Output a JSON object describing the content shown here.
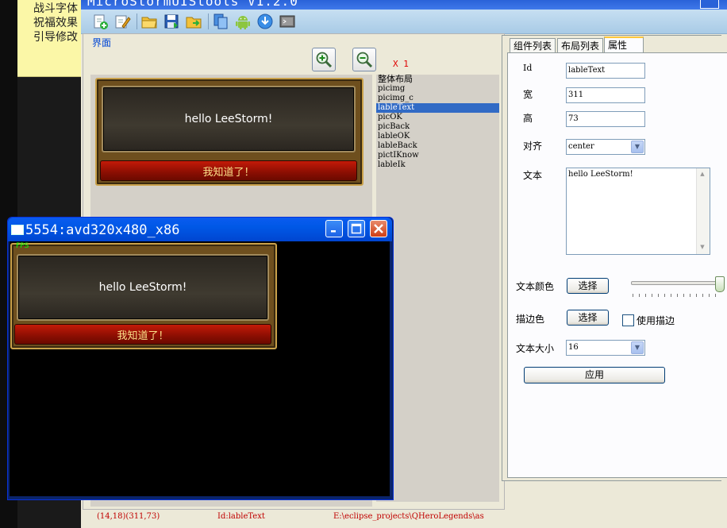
{
  "background_note": {
    "lines": [
      "战斗字体",
      "祝福效果",
      "引导修改"
    ]
  },
  "app": {
    "title": "MicroStormUIStools V1.2.0",
    "toolbar_icons": [
      "new-file-icon",
      "edit-icon",
      "open-folder-icon",
      "save-icon",
      "export-folder-icon",
      "copy-icon",
      "android-icon",
      "download-icon",
      "terminal-icon"
    ]
  },
  "left_panel": {
    "group_label": "界面",
    "zoom_in_icon": "zoom-in-icon",
    "zoom_out_icon": "zoom-out-icon",
    "scale": "X 1",
    "preview": {
      "label_text": "hello LeeStorm!",
      "button_text": "我知道了！"
    },
    "component_list": [
      {
        "label": "整体布局",
        "selected": false
      },
      {
        "label": "picimg",
        "selected": false
      },
      {
        "label": "picimg_c",
        "selected": false
      },
      {
        "label": "lableText",
        "selected": true
      },
      {
        "label": "picOK",
        "selected": false
      },
      {
        "label": "picBack",
        "selected": false
      },
      {
        "label": "lableOK",
        "selected": false
      },
      {
        "label": "lableBack",
        "selected": false
      },
      {
        "label": "pictIKnow",
        "selected": false
      },
      {
        "label": "lableIk",
        "selected": false
      }
    ]
  },
  "right_panel": {
    "tabs": [
      {
        "label": "组件列表",
        "active": false
      },
      {
        "label": "布局列表",
        "active": false
      },
      {
        "label": "属性",
        "active": true
      }
    ],
    "props": {
      "id_label": "Id",
      "id_value": "lableText",
      "width_label": "宽",
      "width_value": "311",
      "height_label": "高",
      "height_value": "73",
      "align_label": "对齐",
      "align_value": "center",
      "text_label": "文本",
      "text_value": "hello LeeStorm!",
      "text_color_label": "文本颜色",
      "text_color_button": "选择",
      "stroke_label": "描边色",
      "stroke_button": "选择",
      "use_stroke_label": "使用描边",
      "use_stroke_checked": false,
      "font_size_label": "文本大小",
      "font_size_value": "16",
      "apply_button": "应用"
    }
  },
  "status_bar": {
    "coords": "(14,18)(311,73)",
    "id": "Id:lableText",
    "path": "E:\\eclipse_projects\\QHeroLegends\\as"
  },
  "emulator": {
    "title": "5554:avd320x480_x86",
    "fps": "FPS",
    "label_text": "hello LeeStorm!",
    "button_text": "我知道了！"
  },
  "colors": {
    "selection": "#316ac5",
    "status_text": "#c00000",
    "accent_blue": "#0046d5"
  }
}
